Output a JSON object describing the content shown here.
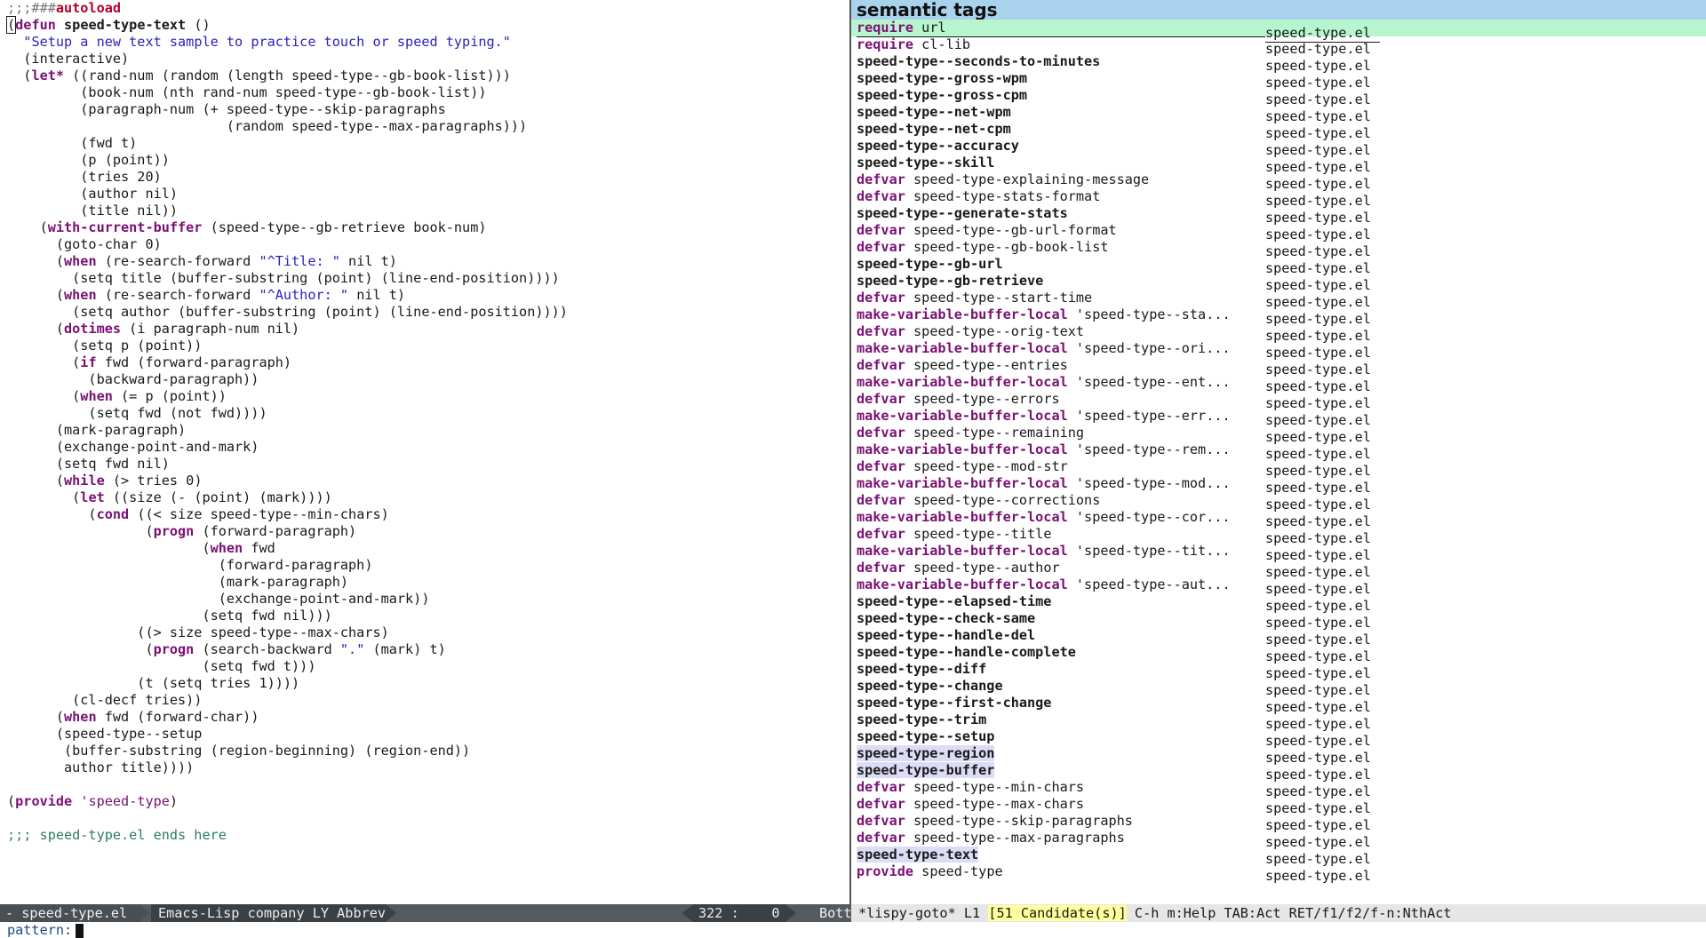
{
  "code": {
    "lines": [
      [
        {
          "t": ";;;###",
          "c": "c-comment"
        },
        {
          "t": "autoload",
          "c": "c-autoload"
        }
      ],
      [
        {
          "t": "(",
          "c": "c-normal cursor-box"
        },
        {
          "t": "defun ",
          "c": "c-kw"
        },
        {
          "t": "speed-type-text",
          "c": "c-fn"
        },
        {
          "t": " ()",
          "c": "c-normal"
        }
      ],
      [
        {
          "t": "  ",
          "c": "c-normal"
        },
        {
          "t": "\"Setup a new text sample to practice touch or speed typing.\"",
          "c": "c-str"
        }
      ],
      [
        {
          "t": "  (interactive)",
          "c": "c-normal"
        }
      ],
      [
        {
          "t": "  (",
          "c": "c-normal"
        },
        {
          "t": "let*",
          "c": "c-kw"
        },
        {
          "t": " ((rand-num (random (length speed-type--gb-book-list)))",
          "c": "c-normal"
        }
      ],
      [
        {
          "t": "         (book-num (nth rand-num speed-type--gb-book-list))",
          "c": "c-normal"
        }
      ],
      [
        {
          "t": "         (paragraph-num (+ speed-type--skip-paragraphs",
          "c": "c-normal"
        }
      ],
      [
        {
          "t": "                           (random speed-type--max-paragraphs)))",
          "c": "c-normal"
        }
      ],
      [
        {
          "t": "         (fwd t)",
          "c": "c-normal"
        }
      ],
      [
        {
          "t": "         (p (point))",
          "c": "c-normal"
        }
      ],
      [
        {
          "t": "         (tries 20)",
          "c": "c-normal"
        }
      ],
      [
        {
          "t": "         (author nil)",
          "c": "c-normal"
        }
      ],
      [
        {
          "t": "         (title nil))",
          "c": "c-normal"
        }
      ],
      [
        {
          "t": "    (",
          "c": "c-normal"
        },
        {
          "t": "with-current-buffer",
          "c": "c-kw"
        },
        {
          "t": " (speed-type--gb-retrieve book-num)",
          "c": "c-normal"
        }
      ],
      [
        {
          "t": "      (goto-char 0)",
          "c": "c-normal"
        }
      ],
      [
        {
          "t": "      (",
          "c": "c-normal"
        },
        {
          "t": "when",
          "c": "c-kw"
        },
        {
          "t": " (re-search-forward ",
          "c": "c-normal"
        },
        {
          "t": "\"^Title: \"",
          "c": "c-str"
        },
        {
          "t": " nil t)",
          "c": "c-normal"
        }
      ],
      [
        {
          "t": "        (setq title (buffer-substring (point) (line-end-position))))",
          "c": "c-normal"
        }
      ],
      [
        {
          "t": "      (",
          "c": "c-normal"
        },
        {
          "t": "when",
          "c": "c-kw"
        },
        {
          "t": " (re-search-forward ",
          "c": "c-normal"
        },
        {
          "t": "\"^Author: \"",
          "c": "c-str"
        },
        {
          "t": " nil t)",
          "c": "c-normal"
        }
      ],
      [
        {
          "t": "        (setq author (buffer-substring (point) (line-end-position))))",
          "c": "c-normal"
        }
      ],
      [
        {
          "t": "      (",
          "c": "c-normal"
        },
        {
          "t": "dotimes",
          "c": "c-kw"
        },
        {
          "t": " (i paragraph-num nil)",
          "c": "c-normal"
        }
      ],
      [
        {
          "t": "        (setq p (point))",
          "c": "c-normal"
        }
      ],
      [
        {
          "t": "        (",
          "c": "c-normal"
        },
        {
          "t": "if",
          "c": "c-kw"
        },
        {
          "t": " fwd (forward-paragraph)",
          "c": "c-normal"
        }
      ],
      [
        {
          "t": "          (backward-paragraph))",
          "c": "c-normal"
        }
      ],
      [
        {
          "t": "        (",
          "c": "c-normal"
        },
        {
          "t": "when",
          "c": "c-kw"
        },
        {
          "t": " (= p (point))",
          "c": "c-normal"
        }
      ],
      [
        {
          "t": "          (setq fwd (not fwd))))",
          "c": "c-normal"
        }
      ],
      [
        {
          "t": "      (mark-paragraph)",
          "c": "c-normal"
        }
      ],
      [
        {
          "t": "      (exchange-point-and-mark)",
          "c": "c-normal"
        }
      ],
      [
        {
          "t": "      (setq fwd nil)",
          "c": "c-normal"
        }
      ],
      [
        {
          "t": "      (",
          "c": "c-normal"
        },
        {
          "t": "while",
          "c": "c-kw"
        },
        {
          "t": " (> tries 0)",
          "c": "c-normal"
        }
      ],
      [
        {
          "t": "        (",
          "c": "c-normal"
        },
        {
          "t": "let",
          "c": "c-kw"
        },
        {
          "t": " ((size (- (point) (mark))))",
          "c": "c-normal"
        }
      ],
      [
        {
          "t": "          (",
          "c": "c-normal"
        },
        {
          "t": "cond",
          "c": "c-kw"
        },
        {
          "t": " ((< size speed-type--min-chars)",
          "c": "c-normal"
        }
      ],
      [
        {
          "t": "                 (",
          "c": "c-normal"
        },
        {
          "t": "progn",
          "c": "c-kw"
        },
        {
          "t": " (forward-paragraph)",
          "c": "c-normal"
        }
      ],
      [
        {
          "t": "                        (",
          "c": "c-normal"
        },
        {
          "t": "when",
          "c": "c-kw"
        },
        {
          "t": " fwd",
          "c": "c-normal"
        }
      ],
      [
        {
          "t": "                          (forward-paragraph)",
          "c": "c-normal"
        }
      ],
      [
        {
          "t": "                          (mark-paragraph)",
          "c": "c-normal"
        }
      ],
      [
        {
          "t": "                          (exchange-point-and-mark))",
          "c": "c-normal"
        }
      ],
      [
        {
          "t": "                        (setq fwd nil)))",
          "c": "c-normal"
        }
      ],
      [
        {
          "t": "                ((> size speed-type--max-chars)",
          "c": "c-normal"
        }
      ],
      [
        {
          "t": "                 (",
          "c": "c-normal"
        },
        {
          "t": "progn",
          "c": "c-kw"
        },
        {
          "t": " (search-backward ",
          "c": "c-normal"
        },
        {
          "t": "\".\"",
          "c": "c-str"
        },
        {
          "t": " (mark) t)",
          "c": "c-normal"
        }
      ],
      [
        {
          "t": "                        (setq fwd t)))",
          "c": "c-normal"
        }
      ],
      [
        {
          "t": "                (t (setq tries 1))))",
          "c": "c-normal"
        }
      ],
      [
        {
          "t": "        (cl-decf tries))",
          "c": "c-normal"
        }
      ],
      [
        {
          "t": "      (",
          "c": "c-normal"
        },
        {
          "t": "when",
          "c": "c-kw"
        },
        {
          "t": " fwd (forward-char))",
          "c": "c-normal"
        }
      ],
      [
        {
          "t": "      (speed-type--setup",
          "c": "c-normal"
        }
      ],
      [
        {
          "t": "       (buffer-substring (region-beginning) (region-end))",
          "c": "c-normal"
        }
      ],
      [
        {
          "t": "       author title))))",
          "c": "c-normal"
        }
      ],
      [
        {
          "t": "",
          "c": "c-normal"
        }
      ],
      [
        {
          "t": "(",
          "c": "c-normal"
        },
        {
          "t": "provide",
          "c": "c-kw"
        },
        {
          "t": " ",
          "c": "c-normal"
        },
        {
          "t": "'speed-type",
          "c": "c-quote"
        },
        {
          "t": ")",
          "c": "c-normal"
        }
      ],
      [
        {
          "t": "",
          "c": "c-normal"
        }
      ],
      [
        {
          "t": ";;; speed-type.el ends here",
          "c": "c-comment-dim"
        }
      ]
    ]
  },
  "tags": {
    "header": "semantic tags",
    "file_label": "speed-type.el",
    "rows": [
      {
        "kind": "require",
        "name": "url",
        "style": "plain",
        "selected": true
      },
      {
        "kind": "require",
        "name": "cl-lib",
        "style": "plain"
      },
      {
        "kind": "",
        "name": "speed-type--seconds-to-minutes",
        "style": "bold"
      },
      {
        "kind": "",
        "name": "speed-type--gross-wpm",
        "style": "bold"
      },
      {
        "kind": "",
        "name": "speed-type--gross-cpm",
        "style": "bold"
      },
      {
        "kind": "",
        "name": "speed-type--net-wpm",
        "style": "bold"
      },
      {
        "kind": "",
        "name": "speed-type--net-cpm",
        "style": "bold"
      },
      {
        "kind": "",
        "name": "speed-type--accuracy",
        "style": "bold"
      },
      {
        "kind": "",
        "name": "speed-type--skill",
        "style": "bold"
      },
      {
        "kind": "defvar",
        "name": "speed-type-explaining-message",
        "style": "plain"
      },
      {
        "kind": "defvar",
        "name": "speed-type-stats-format",
        "style": "plain"
      },
      {
        "kind": "",
        "name": "speed-type--generate-stats",
        "style": "bold"
      },
      {
        "kind": "defvar",
        "name": "speed-type--gb-url-format",
        "style": "plain"
      },
      {
        "kind": "defvar",
        "name": "speed-type--gb-book-list",
        "style": "plain"
      },
      {
        "kind": "",
        "name": "speed-type--gb-url",
        "style": "bold"
      },
      {
        "kind": "",
        "name": "speed-type--gb-retrieve",
        "style": "bold"
      },
      {
        "kind": "defvar",
        "name": "speed-type--start-time",
        "style": "plain"
      },
      {
        "kind": "make-variable-buffer-local",
        "name": "'speed-type--sta...",
        "style": "plain"
      },
      {
        "kind": "defvar",
        "name": "speed-type--orig-text",
        "style": "plain"
      },
      {
        "kind": "make-variable-buffer-local",
        "name": "'speed-type--ori...",
        "style": "plain"
      },
      {
        "kind": "defvar",
        "name": "speed-type--entries",
        "style": "plain"
      },
      {
        "kind": "make-variable-buffer-local",
        "name": "'speed-type--ent...",
        "style": "plain"
      },
      {
        "kind": "defvar",
        "name": "speed-type--errors",
        "style": "plain"
      },
      {
        "kind": "make-variable-buffer-local",
        "name": "'speed-type--err...",
        "style": "plain"
      },
      {
        "kind": "defvar",
        "name": "speed-type--remaining",
        "style": "plain"
      },
      {
        "kind": "make-variable-buffer-local",
        "name": "'speed-type--rem...",
        "style": "plain"
      },
      {
        "kind": "defvar",
        "name": "speed-type--mod-str",
        "style": "plain"
      },
      {
        "kind": "make-variable-buffer-local",
        "name": "'speed-type--mod...",
        "style": "plain"
      },
      {
        "kind": "defvar",
        "name": "speed-type--corrections",
        "style": "plain"
      },
      {
        "kind": "make-variable-buffer-local",
        "name": "'speed-type--cor...",
        "style": "plain"
      },
      {
        "kind": "defvar",
        "name": "speed-type--title",
        "style": "plain"
      },
      {
        "kind": "make-variable-buffer-local",
        "name": "'speed-type--tit...",
        "style": "plain"
      },
      {
        "kind": "defvar",
        "name": "speed-type--author",
        "style": "plain"
      },
      {
        "kind": "make-variable-buffer-local",
        "name": "'speed-type--aut...",
        "style": "plain"
      },
      {
        "kind": "",
        "name": "speed-type--elapsed-time",
        "style": "bold"
      },
      {
        "kind": "",
        "name": "speed-type--check-same",
        "style": "bold"
      },
      {
        "kind": "",
        "name": "speed-type--handle-del",
        "style": "bold"
      },
      {
        "kind": "",
        "name": "speed-type--handle-complete",
        "style": "bold"
      },
      {
        "kind": "",
        "name": "speed-type--diff",
        "style": "bold"
      },
      {
        "kind": "",
        "name": "speed-type--change",
        "style": "bold"
      },
      {
        "kind": "",
        "name": "speed-type--first-change",
        "style": "bold"
      },
      {
        "kind": "",
        "name": "speed-type--trim",
        "style": "bold"
      },
      {
        "kind": "",
        "name": "speed-type--setup",
        "style": "bold"
      },
      {
        "kind": "",
        "name": "speed-type-region",
        "style": "hl"
      },
      {
        "kind": "",
        "name": "speed-type-buffer",
        "style": "hl"
      },
      {
        "kind": "defvar",
        "name": "speed-type--min-chars",
        "style": "plain"
      },
      {
        "kind": "defvar",
        "name": "speed-type--max-chars",
        "style": "plain"
      },
      {
        "kind": "defvar",
        "name": "speed-type--skip-paragraphs",
        "style": "plain"
      },
      {
        "kind": "defvar",
        "name": "speed-type--max-paragraphs",
        "style": "plain"
      },
      {
        "kind": "",
        "name": "speed-type-text",
        "style": "hl"
      },
      {
        "kind": "provide",
        "name": "speed-type",
        "style": "plain"
      }
    ]
  },
  "modeline": {
    "file": "- speed-type.el",
    "modes": "Emacs-Lisp company LY Abbrev",
    "line": "322 :",
    "col": "0",
    "where": "Bottom",
    "right_buffer": "*lispy-goto* L1",
    "candidates": "[51 Candidate(s)]",
    "help": "C-h m:Help TAB:Act RET/f1/f2/f-n:NthAct"
  },
  "minibuffer": {
    "prompt": "pattern:"
  },
  "colors": {
    "keyword": "#7a1173",
    "string": "#2c22bb",
    "selected_row": "#b7f5cf",
    "header_bg": "#a9d3ec",
    "modeline_bg": "#555a5f",
    "candidates_bg": "#ffff9e"
  }
}
